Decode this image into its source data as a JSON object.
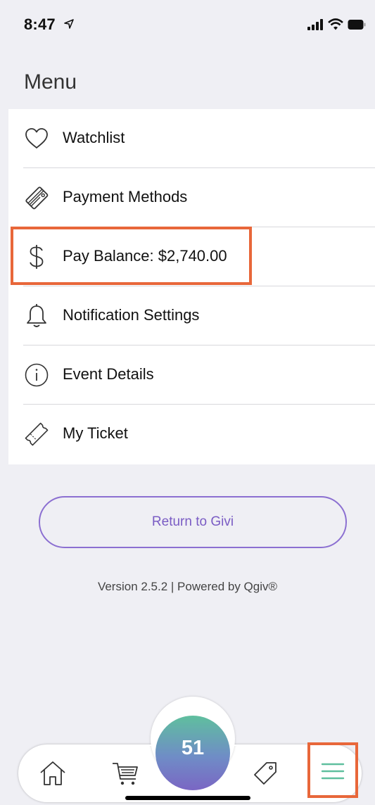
{
  "status_bar": {
    "time": "8:47"
  },
  "menu": {
    "title": "Menu",
    "items": [
      {
        "label": "Watchlist",
        "icon": "heart-icon"
      },
      {
        "label": "Payment Methods",
        "icon": "credit-card-icon"
      },
      {
        "label": "Pay Balance: $2,740.00",
        "icon": "dollar-icon"
      },
      {
        "label": "Notification Settings",
        "icon": "bell-icon"
      },
      {
        "label": "Event Details",
        "icon": "info-icon"
      },
      {
        "label": "My Ticket",
        "icon": "ticket-icon"
      }
    ]
  },
  "return_button": {
    "label": "Return to Givi"
  },
  "footer": {
    "version_text": "Version 2.5.2 | Powered by Qgiv®"
  },
  "tab_bar": {
    "items": [
      {
        "name": "home",
        "icon": "home-icon"
      },
      {
        "name": "cart",
        "icon": "cart-icon"
      },
      {
        "name": "paddle-number",
        "value": "51"
      },
      {
        "name": "tag",
        "icon": "tag-icon"
      },
      {
        "name": "menu",
        "icon": "hamburger-menu-icon"
      }
    ]
  },
  "colors": {
    "background": "#efeff4",
    "highlight": "#e8673a",
    "accent_purple": "#7a5cc4",
    "accent_green": "#5fbf9e"
  }
}
